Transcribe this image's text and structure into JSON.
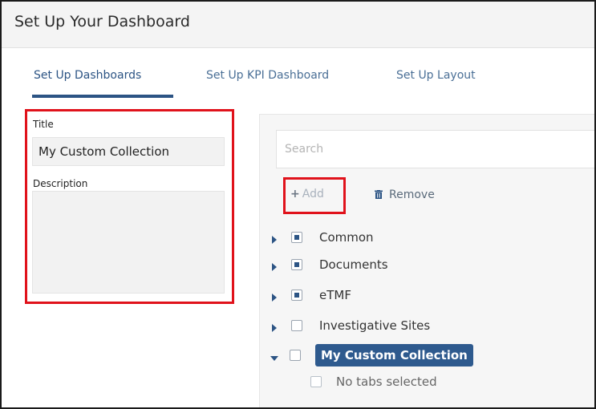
{
  "window": {
    "title": "Set Up Your Dashboard"
  },
  "tabs": [
    {
      "label": "Set Up Dashboards",
      "active": true
    },
    {
      "label": "Set Up KPI Dashboard",
      "active": false
    },
    {
      "label": "Set Up Layout",
      "active": false
    }
  ],
  "form": {
    "title_label": "Title",
    "title_value": "My Custom Collection",
    "description_label": "Description",
    "description_value": ""
  },
  "search": {
    "placeholder": "Search",
    "value": ""
  },
  "actions": {
    "add_label": "Add",
    "remove_label": "Remove"
  },
  "tree": {
    "items": [
      {
        "label": "Common",
        "expanded": false,
        "checked": "partial"
      },
      {
        "label": "Documents",
        "expanded": false,
        "checked": "partial"
      },
      {
        "label": "eTMF",
        "expanded": false,
        "checked": "partial"
      },
      {
        "label": "Investigative Sites",
        "expanded": false,
        "checked": "none"
      },
      {
        "label": "My Custom Collection",
        "expanded": true,
        "checked": "none",
        "selected": true
      }
    ],
    "empty_child_label": "No tabs selected"
  },
  "colors": {
    "accent": "#2c5484",
    "highlight_border": "#e0121b",
    "selected_node_bg": "#2e5a8e"
  }
}
